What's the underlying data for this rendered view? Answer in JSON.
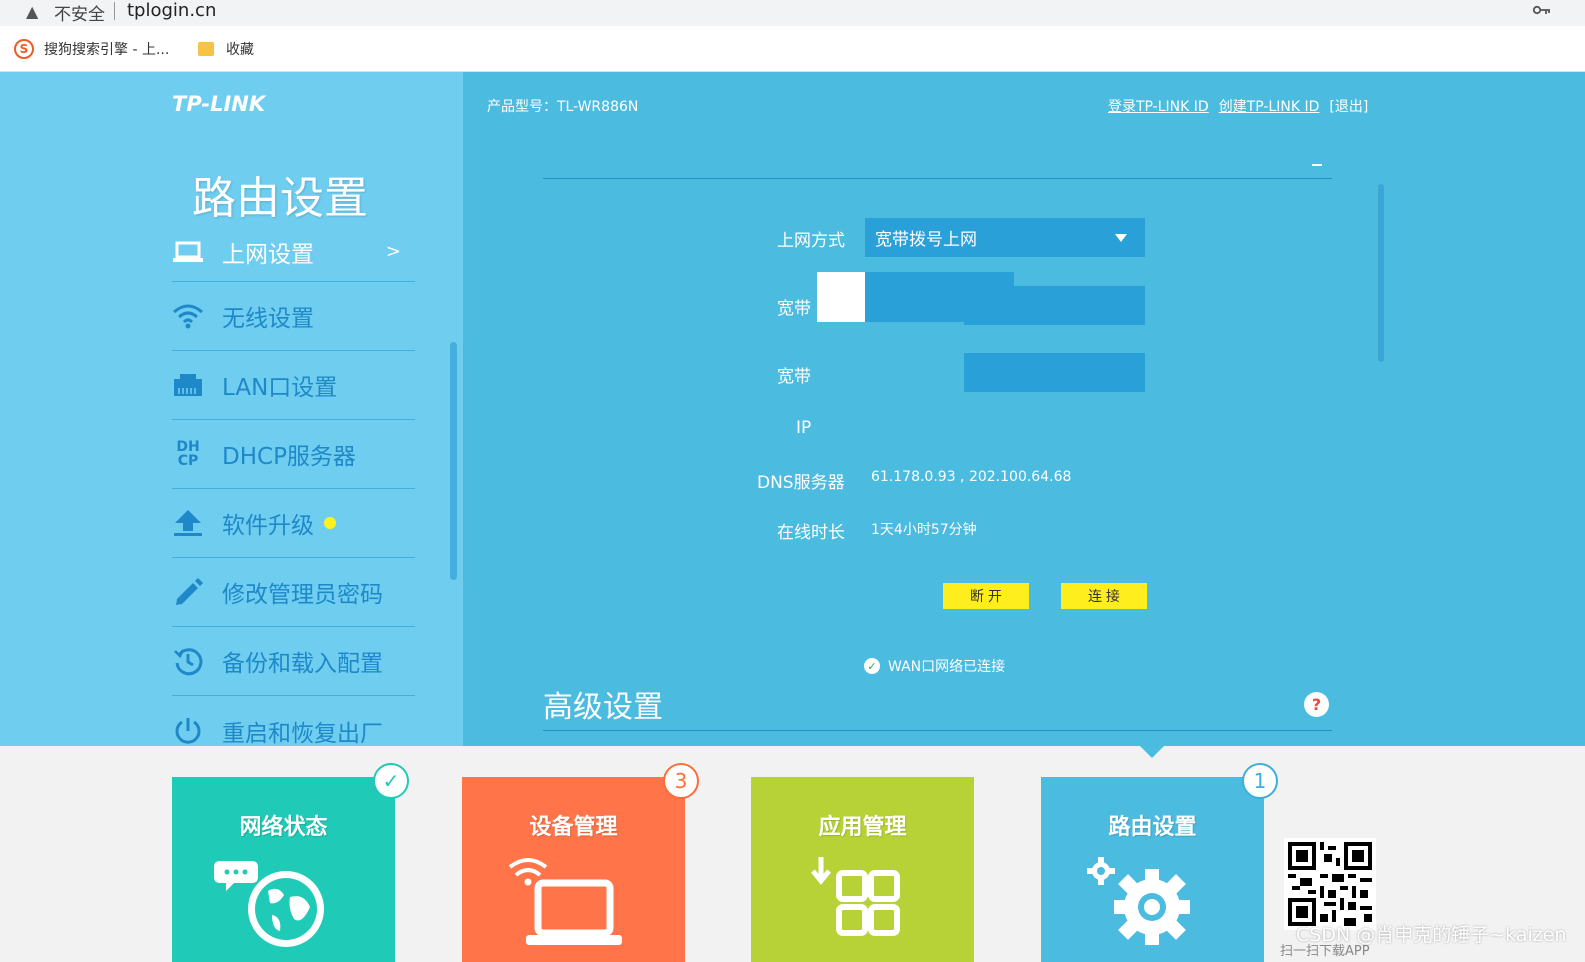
{
  "browser": {
    "warning": "▲",
    "insecure_label": "不安全",
    "url": "tplogin.cn",
    "key_icon": "key-icon"
  },
  "bookmarks": [
    {
      "label": "搜狗搜索引擎 - 上...",
      "icon": "sogou-icon"
    },
    {
      "label": "收藏",
      "icon": "folder-icon"
    }
  ],
  "header": {
    "logo": "TP-LINK",
    "model": "产品型号：TL-WR886N",
    "links": [
      "登录TP-LINK ID",
      "创建TP-LINK ID"
    ],
    "logout": "[退出]"
  },
  "sidebar": {
    "title": "路由设置",
    "items": [
      {
        "label": "上网设置",
        "arrow": ">"
      },
      {
        "label": "无线设置"
      },
      {
        "label": "LAN口设置"
      },
      {
        "label": "DHCP服务器"
      },
      {
        "label": "软件升级"
      },
      {
        "label": "修改管理员密码"
      },
      {
        "label": "备份和载入配置"
      },
      {
        "label": "重启和恢复出厂"
      }
    ]
  },
  "form": {
    "connection_type_label": "上网方式",
    "connection_type_value": "宽带拨号上网",
    "account_label": "宽带",
    "password_label": "宽带",
    "ip_label": "IP",
    "dns_label": "DNS服务器",
    "dns_value": "61.178.0.93 , 202.100.64.68",
    "uptime_label": "在线时长",
    "uptime_value": "1天4小时57分钟",
    "disconnect_label": "断 开",
    "connect_label": "连 接",
    "wan_status": "WAN口网络已连接"
  },
  "advanced": {
    "title": "高级设置",
    "help": "?"
  },
  "tiles": [
    {
      "label": "网络状态",
      "badge": "✓",
      "color": "#1fcab7",
      "badge_color": "#1fcab7"
    },
    {
      "label": "设备管理",
      "badge": "3",
      "color": "#ff7448",
      "badge_color": "#ff6d3a"
    },
    {
      "label": "应用管理",
      "badge": "",
      "color": "#b7d236",
      "badge_color": "#b7d236"
    },
    {
      "label": "路由设置",
      "badge": "1",
      "color": "#4bbbe0",
      "badge_color": "#3eaedc"
    }
  ],
  "qr": {
    "caption": "扫一扫下载APP"
  },
  "watermark": "CSDN @肖申克的锤子~kaizen"
}
